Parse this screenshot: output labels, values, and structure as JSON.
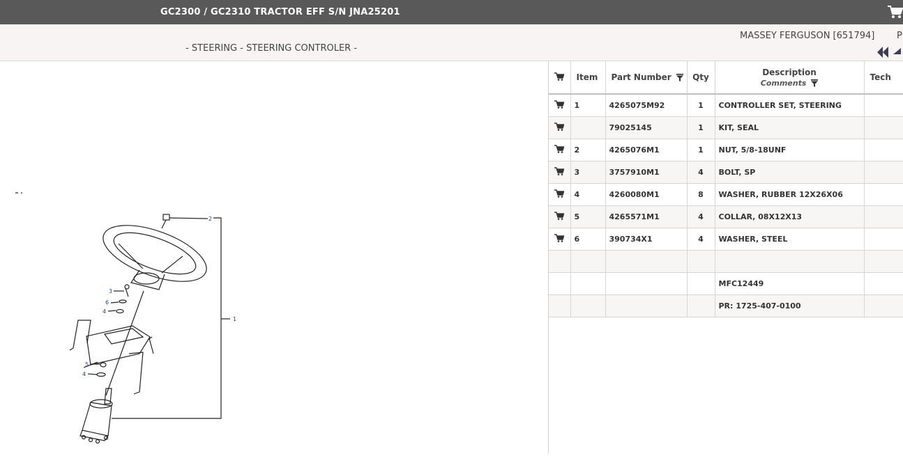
{
  "header": {
    "title": "GC2300 / GC2310 TRACTOR EFF S/N JNA25201",
    "cart_icon": "cart-icon"
  },
  "subheader": {
    "section": "- STEERING - STEERING CONTROLER -",
    "brand": "MASSEY FERGUSON [651794]",
    "cut_text": "P"
  },
  "diagram": {
    "callouts": [
      "2",
      "3",
      "6",
      "4",
      "1",
      "5",
      "4"
    ]
  },
  "table": {
    "headers": {
      "item": "Item",
      "part_number": "Part Number",
      "qty": "Qty",
      "description": "Description",
      "comments": "Comments",
      "tech": "Tech"
    },
    "rows": [
      {
        "item": "1",
        "part": "4265075M92",
        "qty": "1",
        "desc": "CONTROLLER SET, STEERING",
        "cart": true
      },
      {
        "item": "",
        "part": "79025145",
        "qty": "1",
        "desc": "KIT, SEAL",
        "cart": true
      },
      {
        "item": "2",
        "part": "4265076M1",
        "qty": "1",
        "desc": "NUT, 5/8-18UNF",
        "cart": true
      },
      {
        "item": "3",
        "part": "3757910M1",
        "qty": "4",
        "desc": "BOLT, SP",
        "cart": true
      },
      {
        "item": "4",
        "part": "4260080M1",
        "qty": "8",
        "desc": "WASHER, RUBBER 12X26X06",
        "cart": true
      },
      {
        "item": "5",
        "part": "4265571M1",
        "qty": "4",
        "desc": "COLLAR, 08X12X13",
        "cart": true
      },
      {
        "item": "6",
        "part": "390734X1",
        "qty": "4",
        "desc": "WASHER, STEEL",
        "cart": true
      },
      {
        "item": "",
        "part": "",
        "qty": "",
        "desc": "",
        "cart": false
      },
      {
        "item": "",
        "part": "",
        "qty": "",
        "desc": "MFC12449",
        "cart": false
      },
      {
        "item": "",
        "part": "",
        "qty": "",
        "desc": "PR: 1725-407-0100",
        "cart": false
      }
    ]
  },
  "colors": {
    "topbar": "#595959",
    "subbar": "#f7f4f3",
    "callout": "#1a3fb0"
  }
}
